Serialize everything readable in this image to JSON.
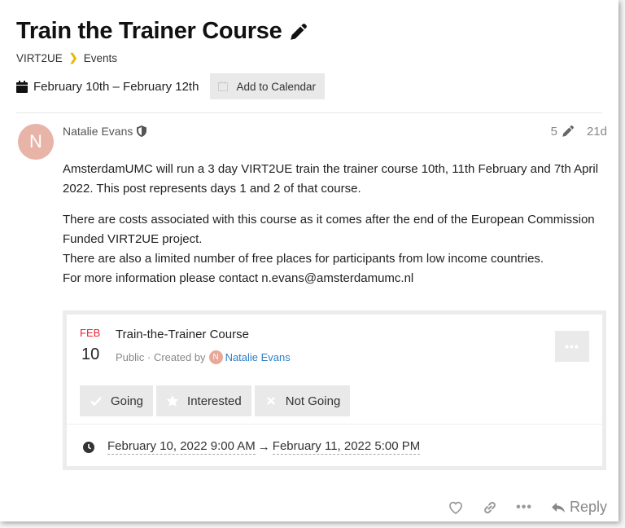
{
  "topic": {
    "title": "Train the Trainer Course",
    "breadcrumb": {
      "category": "VIRT2UE",
      "subcategory": "Events"
    },
    "date_range": "February 10th – February 12th",
    "add_to_calendar_label": "Add to Calendar"
  },
  "post": {
    "author": "Natalie Evans",
    "avatar_letter": "N",
    "edit_count": "5",
    "age": "21d",
    "paragraphs": [
      "AmsterdamUMC will run a 3 day VIRT2UE train the trainer course 10th, 11th February and 7th April 2022. This post represents days 1 and 2 of that course.",
      "There are costs associated with this course as it comes after the end of the European Commission Funded VIRT2UE project.",
      "There are also a limited number of free places for participants from low income countries.",
      "For more information please contact n.evans@amsterdamumc.nl"
    ]
  },
  "event": {
    "month": "FEB",
    "day": "10",
    "name": "Train-the-Trainer Course",
    "visibility": "Public · Created by",
    "creator_avatar_letter": "N",
    "creator": "Natalie Evans",
    "more_label": "•••",
    "rsvp": {
      "going": "Going",
      "interested": "Interested",
      "not_going": "Not Going"
    },
    "start": "February 10, 2022 9:00 AM",
    "arrow": "→",
    "end": "February 11, 2022 5:00 PM"
  },
  "actions": {
    "more": "•••",
    "reply": "Reply"
  },
  "colors": {
    "accent_chevron": "#e9b800",
    "month": "#e22233",
    "link": "#2f7ec6",
    "avatar": "#e8b4a8"
  },
  "icons": [
    "pencil-icon",
    "calendar-icon",
    "shield-icon",
    "clock-icon",
    "check-icon",
    "star-icon",
    "x-icon",
    "heart-icon",
    "link-icon",
    "reply-icon"
  ]
}
